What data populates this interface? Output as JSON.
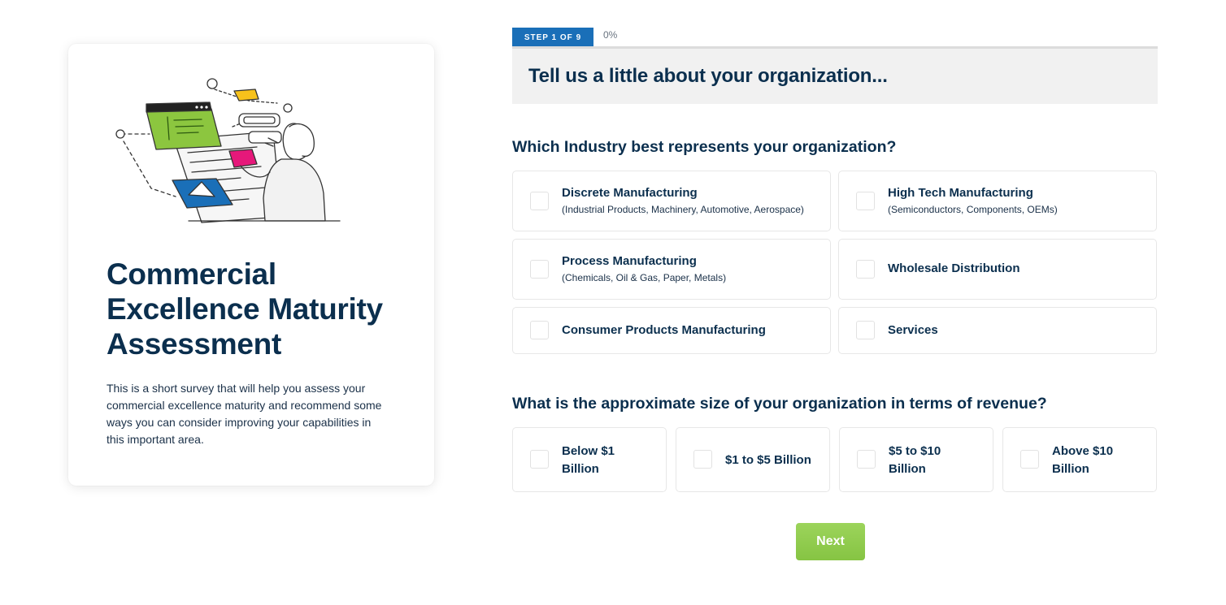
{
  "intro": {
    "title": "Commercial Excellence Maturity Assessment",
    "description": "This is a short survey that will help you assess your commercial excellence maturity and recommend some ways you can consider improving your capabilities in this important area."
  },
  "progress": {
    "step_label": "STEP 1 OF 9",
    "percent_label": "0%",
    "percent": 0
  },
  "section": {
    "heading": "Tell us a little about your organization..."
  },
  "questions": [
    {
      "text": "Which Industry best represents your organization?",
      "options": [
        {
          "label": "Discrete Manufacturing",
          "sub": "(Industrial Products, Machinery, Automotive, Aerospace)",
          "checked": false
        },
        {
          "label": "High Tech Manufacturing",
          "sub": "(Semiconductors, Components, OEMs)",
          "checked": false
        },
        {
          "label": "Process Manufacturing",
          "sub": "(Chemicals, Oil & Gas, Paper, Metals)",
          "checked": false
        },
        {
          "label": "Wholesale Distribution",
          "sub": "",
          "checked": false
        },
        {
          "label": "Consumer Products Manufacturing",
          "sub": "",
          "checked": false
        },
        {
          "label": "Services",
          "sub": "",
          "checked": false
        }
      ]
    },
    {
      "text": "What is the approximate size of your organization in terms of revenue?",
      "options": [
        {
          "label": "Below $1 Billion",
          "checked": false
        },
        {
          "label": "$1 to $5 Billion",
          "checked": false
        },
        {
          "label": "$5 to $10 Billion",
          "checked": false
        },
        {
          "label": "Above $10 Billion",
          "checked": false
        }
      ]
    }
  ],
  "actions": {
    "next_label": "Next"
  },
  "colors": {
    "brand_navy": "#0b2f4e",
    "step_blue": "#1a6fb8",
    "next_green": "#8ccb4a",
    "illustration_green": "#8cc63f",
    "illustration_blue": "#1a6fb8",
    "illustration_pink": "#e6187a",
    "illustration_yellow": "#f7c21b"
  }
}
